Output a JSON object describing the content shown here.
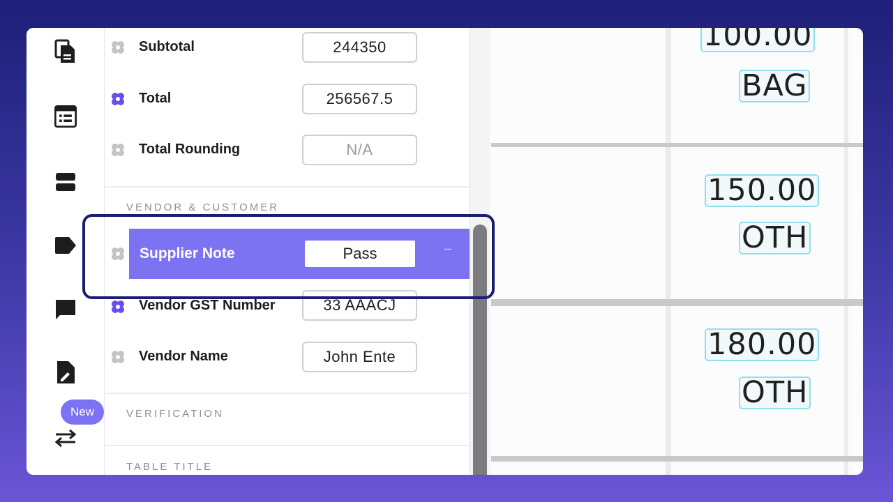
{
  "rail": {
    "items": [
      {
        "icon": "documents-icon"
      },
      {
        "icon": "form-list-icon"
      },
      {
        "icon": "sections-icon"
      },
      {
        "icon": "tag-icon"
      },
      {
        "icon": "comment-icon"
      },
      {
        "icon": "document-edit-icon"
      },
      {
        "icon": "swap-icon"
      }
    ],
    "new_badge": "New"
  },
  "fields": {
    "subtotal": {
      "label": "Subtotal",
      "value": "244350"
    },
    "total": {
      "label": "Total",
      "value": "256567.5"
    },
    "total_rounding": {
      "label": "Total Rounding",
      "value": "N/A"
    },
    "supplier_note": {
      "label": "Supplier Note",
      "value": "Pass"
    },
    "vendor_gst_number": {
      "label": "Vendor GST Number",
      "value": "33 AAACJ"
    },
    "vendor_name": {
      "label": "Vendor Name",
      "value": "John Ente"
    }
  },
  "sections": {
    "vendor_customer": "VENDOR & CUSTOMER",
    "verification": "VERIFICATION",
    "table_title": "TABLE TITLE"
  },
  "document": {
    "cells": [
      "100.00",
      "BAG",
      "150.00",
      "OTH",
      "180.00",
      "OTH"
    ]
  },
  "colors": {
    "accent": "#7b73f2",
    "outline": "#1b1d6e",
    "required_icon": "#6b4cf0",
    "optional_icon": "#c4c4c8"
  }
}
